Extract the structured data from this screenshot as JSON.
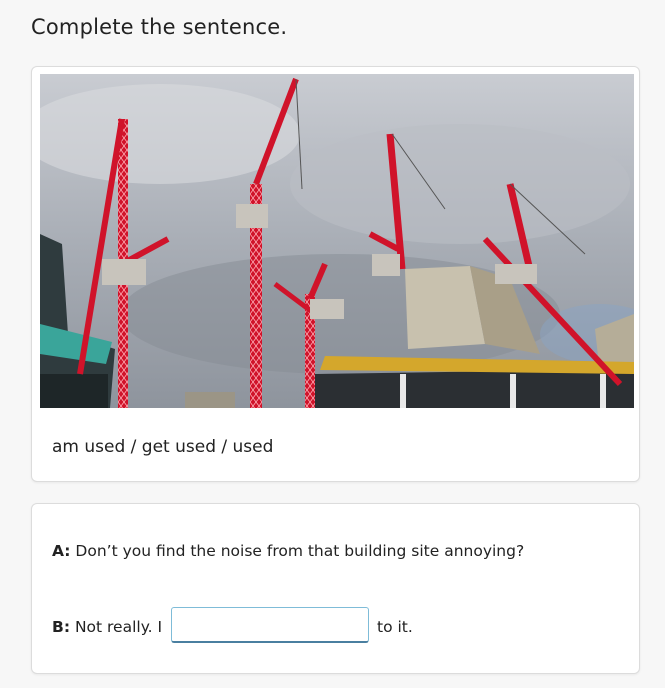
{
  "instruction": "Complete the sentence.",
  "image": {
    "alt": "Red tower cranes over a building site against a cloudy sky",
    "crane_color": "#d0132a",
    "sky_color": "#a9aeb6"
  },
  "options_text": "am used / get used / used",
  "dialogue": {
    "a_speaker": "A:",
    "a_text": " Don’t you find the noise from that building site annoying?",
    "b_speaker": "B:",
    "b_text_before": " Not really. I",
    "answer_value": "",
    "b_text_after": "to it."
  }
}
